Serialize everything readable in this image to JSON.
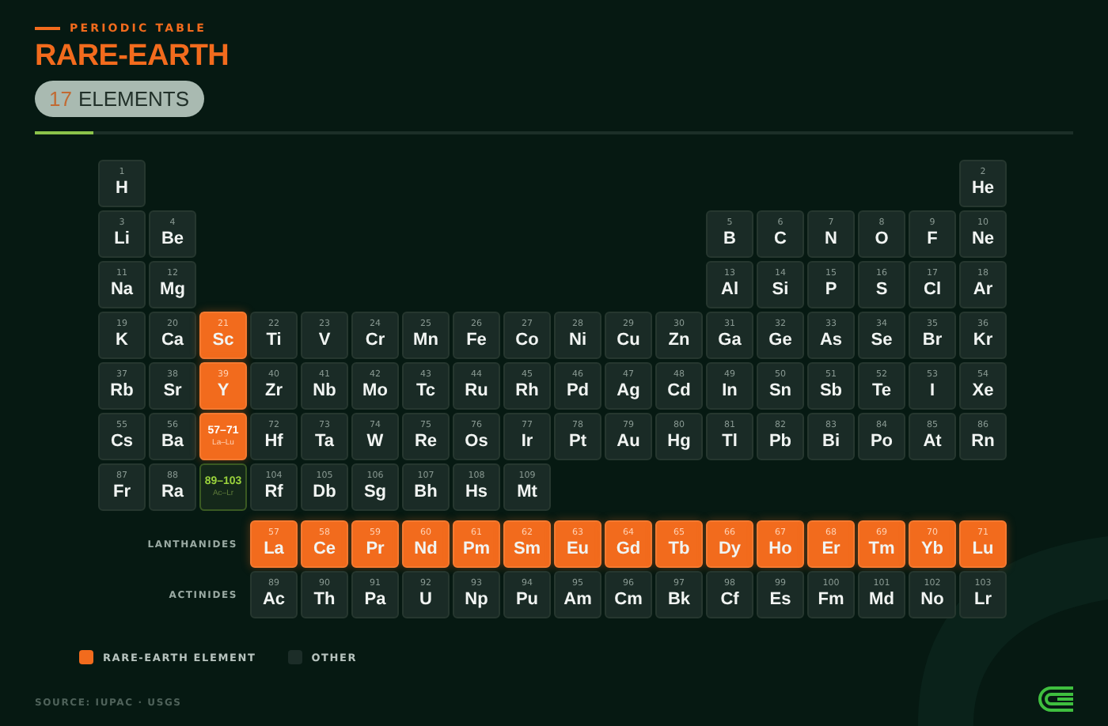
{
  "header": {
    "eyebrow": "PERIODIC TABLE",
    "title": "RARE-EARTH",
    "pill": {
      "count": "17",
      "label": "ELEMENTS"
    }
  },
  "table": {
    "rows": [
      {
        "left": [
          {
            "kind": "element",
            "number": "1",
            "symbol": "H",
            "rare_earth": false
          }
        ],
        "right": [
          {
            "kind": "element",
            "number": "2",
            "symbol": "He",
            "rare_earth": false
          }
        ]
      },
      {
        "left": [
          {
            "kind": "element",
            "number": "3",
            "symbol": "Li",
            "rare_earth": false
          },
          {
            "kind": "element",
            "number": "4",
            "symbol": "Be",
            "rare_earth": false
          }
        ],
        "right": [
          {
            "kind": "element",
            "number": "5",
            "symbol": "B",
            "rare_earth": false
          },
          {
            "kind": "element",
            "number": "6",
            "symbol": "C",
            "rare_earth": false
          },
          {
            "kind": "element",
            "number": "7",
            "symbol": "N",
            "rare_earth": false
          },
          {
            "kind": "element",
            "number": "8",
            "symbol": "O",
            "rare_earth": false
          },
          {
            "kind": "element",
            "number": "9",
            "symbol": "F",
            "rare_earth": false
          },
          {
            "kind": "element",
            "number": "10",
            "symbol": "Ne",
            "rare_earth": false
          }
        ]
      },
      {
        "left": [
          {
            "kind": "element",
            "number": "11",
            "symbol": "Na",
            "rare_earth": false
          },
          {
            "kind": "element",
            "number": "12",
            "symbol": "Mg",
            "rare_earth": false
          }
        ],
        "right": [
          {
            "kind": "element",
            "number": "13",
            "symbol": "Al",
            "rare_earth": false
          },
          {
            "kind": "element",
            "number": "14",
            "symbol": "Si",
            "rare_earth": false
          },
          {
            "kind": "element",
            "number": "15",
            "symbol": "P",
            "rare_earth": false
          },
          {
            "kind": "element",
            "number": "16",
            "symbol": "S",
            "rare_earth": false
          },
          {
            "kind": "element",
            "number": "17",
            "symbol": "Cl",
            "rare_earth": false
          },
          {
            "kind": "element",
            "number": "18",
            "symbol": "Ar",
            "rare_earth": false
          }
        ]
      },
      {
        "left": [
          {
            "kind": "element",
            "number": "19",
            "symbol": "K",
            "rare_earth": false
          },
          {
            "kind": "element",
            "number": "20",
            "symbol": "Ca",
            "rare_earth": false
          },
          {
            "kind": "element",
            "number": "21",
            "symbol": "Sc",
            "rare_earth": true
          },
          {
            "kind": "element",
            "number": "22",
            "symbol": "Ti",
            "rare_earth": false
          },
          {
            "kind": "element",
            "number": "23",
            "symbol": "V",
            "rare_earth": false
          },
          {
            "kind": "element",
            "number": "24",
            "symbol": "Cr",
            "rare_earth": false
          },
          {
            "kind": "element",
            "number": "25",
            "symbol": "Mn",
            "rare_earth": false
          },
          {
            "kind": "element",
            "number": "26",
            "symbol": "Fe",
            "rare_earth": false
          },
          {
            "kind": "element",
            "number": "27",
            "symbol": "Co",
            "rare_earth": false
          },
          {
            "kind": "element",
            "number": "28",
            "symbol": "Ni",
            "rare_earth": false
          },
          {
            "kind": "element",
            "number": "29",
            "symbol": "Cu",
            "rare_earth": false
          },
          {
            "kind": "element",
            "number": "30",
            "symbol": "Zn",
            "rare_earth": false
          },
          {
            "kind": "element",
            "number": "31",
            "symbol": "Ga",
            "rare_earth": false
          },
          {
            "kind": "element",
            "number": "32",
            "symbol": "Ge",
            "rare_earth": false
          },
          {
            "kind": "element",
            "number": "33",
            "symbol": "As",
            "rare_earth": false
          },
          {
            "kind": "element",
            "number": "34",
            "symbol": "Se",
            "rare_earth": false
          },
          {
            "kind": "element",
            "number": "35",
            "symbol": "Br",
            "rare_earth": false
          },
          {
            "kind": "element",
            "number": "36",
            "symbol": "Kr",
            "rare_earth": false
          }
        ],
        "right": []
      },
      {
        "left": [
          {
            "kind": "element",
            "number": "37",
            "symbol": "Rb",
            "rare_earth": false
          },
          {
            "kind": "element",
            "number": "38",
            "symbol": "Sr",
            "rare_earth": false
          },
          {
            "kind": "element",
            "number": "39",
            "symbol": "Y",
            "rare_earth": true
          },
          {
            "kind": "element",
            "number": "40",
            "symbol": "Zr",
            "rare_earth": false
          },
          {
            "kind": "element",
            "number": "41",
            "symbol": "Nb",
            "rare_earth": false
          },
          {
            "kind": "element",
            "number": "42",
            "symbol": "Mo",
            "rare_earth": false
          },
          {
            "kind": "element",
            "number": "43",
            "symbol": "Tc",
            "rare_earth": false
          },
          {
            "kind": "element",
            "number": "44",
            "symbol": "Ru",
            "rare_earth": false
          },
          {
            "kind": "element",
            "number": "45",
            "symbol": "Rh",
            "rare_earth": false
          },
          {
            "kind": "element",
            "number": "46",
            "symbol": "Pd",
            "rare_earth": false
          },
          {
            "kind": "element",
            "number": "47",
            "symbol": "Ag",
            "rare_earth": false
          },
          {
            "kind": "element",
            "number": "48",
            "symbol": "Cd",
            "rare_earth": false
          },
          {
            "kind": "element",
            "number": "49",
            "symbol": "In",
            "rare_earth": false
          },
          {
            "kind": "element",
            "number": "50",
            "symbol": "Sn",
            "rare_earth": false
          },
          {
            "kind": "element",
            "number": "51",
            "symbol": "Sb",
            "rare_earth": false
          },
          {
            "kind": "element",
            "number": "52",
            "symbol": "Te",
            "rare_earth": false
          },
          {
            "kind": "element",
            "number": "53",
            "symbol": "I",
            "rare_earth": false
          },
          {
            "kind": "element",
            "number": "54",
            "symbol": "Xe",
            "rare_earth": false
          }
        ],
        "right": []
      },
      {
        "left": [
          {
            "kind": "element",
            "number": "55",
            "symbol": "Cs",
            "rare_earth": false
          },
          {
            "kind": "element",
            "number": "56",
            "symbol": "Ba",
            "rare_earth": false
          },
          {
            "kind": "range",
            "number": "57–71",
            "symbol": "La–Lu",
            "rare_earth": true
          },
          {
            "kind": "element",
            "number": "72",
            "symbol": "Hf",
            "rare_earth": false
          },
          {
            "kind": "element",
            "number": "73",
            "symbol": "Ta",
            "rare_earth": false
          },
          {
            "kind": "element",
            "number": "74",
            "symbol": "W",
            "rare_earth": false
          },
          {
            "kind": "element",
            "number": "75",
            "symbol": "Re",
            "rare_earth": false
          },
          {
            "kind": "element",
            "number": "76",
            "symbol": "Os",
            "rare_earth": false
          },
          {
            "kind": "element",
            "number": "77",
            "symbol": "Ir",
            "rare_earth": false
          },
          {
            "kind": "element",
            "number": "78",
            "symbol": "Pt",
            "rare_earth": false
          },
          {
            "kind": "element",
            "number": "79",
            "symbol": "Au",
            "rare_earth": false
          },
          {
            "kind": "element",
            "number": "80",
            "symbol": "Hg",
            "rare_earth": false
          },
          {
            "kind": "element",
            "number": "81",
            "symbol": "Tl",
            "rare_earth": false
          },
          {
            "kind": "element",
            "number": "82",
            "symbol": "Pb",
            "rare_earth": false
          },
          {
            "kind": "element",
            "number": "83",
            "symbol": "Bi",
            "rare_earth": false
          },
          {
            "kind": "element",
            "number": "84",
            "symbol": "Po",
            "rare_earth": false
          },
          {
            "kind": "element",
            "number": "85",
            "symbol": "At",
            "rare_earth": false
          },
          {
            "kind": "element",
            "number": "86",
            "symbol": "Rn",
            "rare_earth": false
          }
        ],
        "right": []
      },
      {
        "left": [
          {
            "kind": "element",
            "number": "87",
            "symbol": "Fr",
            "rare_earth": false
          },
          {
            "kind": "element",
            "number": "88",
            "symbol": "Ra",
            "rare_earth": false
          },
          {
            "kind": "range",
            "number": "89–103",
            "symbol": "Ac–Lr",
            "rare_earth": false
          },
          {
            "kind": "element",
            "number": "104",
            "symbol": "Rf",
            "rare_earth": false
          },
          {
            "kind": "element",
            "number": "105",
            "symbol": "Db",
            "rare_earth": false
          },
          {
            "kind": "element",
            "number": "106",
            "symbol": "Sg",
            "rare_earth": false
          },
          {
            "kind": "element",
            "number": "107",
            "symbol": "Bh",
            "rare_earth": false
          },
          {
            "kind": "element",
            "number": "108",
            "symbol": "Hs",
            "rare_earth": false
          },
          {
            "kind": "element",
            "number": "109",
            "symbol": "Mt",
            "rare_earth": false
          }
        ],
        "right": []
      }
    ],
    "series": [
      {
        "label": "LANTHANIDES",
        "cells": [
          {
            "kind": "element",
            "number": "57",
            "symbol": "La",
            "rare_earth": true
          },
          {
            "kind": "element",
            "number": "58",
            "symbol": "Ce",
            "rare_earth": true
          },
          {
            "kind": "element",
            "number": "59",
            "symbol": "Pr",
            "rare_earth": true
          },
          {
            "kind": "element",
            "number": "60",
            "symbol": "Nd",
            "rare_earth": true
          },
          {
            "kind": "element",
            "number": "61",
            "symbol": "Pm",
            "rare_earth": true
          },
          {
            "kind": "element",
            "number": "62",
            "symbol": "Sm",
            "rare_earth": true
          },
          {
            "kind": "element",
            "number": "63",
            "symbol": "Eu",
            "rare_earth": true
          },
          {
            "kind": "element",
            "number": "64",
            "symbol": "Gd",
            "rare_earth": true
          },
          {
            "kind": "element",
            "number": "65",
            "symbol": "Tb",
            "rare_earth": true
          },
          {
            "kind": "element",
            "number": "66",
            "symbol": "Dy",
            "rare_earth": true
          },
          {
            "kind": "element",
            "number": "67",
            "symbol": "Ho",
            "rare_earth": true
          },
          {
            "kind": "element",
            "number": "68",
            "symbol": "Er",
            "rare_earth": true
          },
          {
            "kind": "element",
            "number": "69",
            "symbol": "Tm",
            "rare_earth": true
          },
          {
            "kind": "element",
            "number": "70",
            "symbol": "Yb",
            "rare_earth": true
          },
          {
            "kind": "element",
            "number": "71",
            "symbol": "Lu",
            "rare_earth": true
          }
        ]
      },
      {
        "label": "ACTINIDES",
        "cells": [
          {
            "kind": "element",
            "number": "89",
            "symbol": "Ac",
            "rare_earth": false
          },
          {
            "kind": "element",
            "number": "90",
            "symbol": "Th",
            "rare_earth": false
          },
          {
            "kind": "element",
            "number": "91",
            "symbol": "Pa",
            "rare_earth": false
          },
          {
            "kind": "element",
            "number": "92",
            "symbol": "U",
            "rare_earth": false
          },
          {
            "kind": "element",
            "number": "93",
            "symbol": "Np",
            "rare_earth": false
          },
          {
            "kind": "element",
            "number": "94",
            "symbol": "Pu",
            "rare_earth": false
          },
          {
            "kind": "element",
            "number": "95",
            "symbol": "Am",
            "rare_earth": false
          },
          {
            "kind": "element",
            "number": "96",
            "symbol": "Cm",
            "rare_earth": false
          },
          {
            "kind": "element",
            "number": "97",
            "symbol": "Bk",
            "rare_earth": false
          },
          {
            "kind": "element",
            "number": "98",
            "symbol": "Cf",
            "rare_earth": false
          },
          {
            "kind": "element",
            "number": "99",
            "symbol": "Es",
            "rare_earth": false
          },
          {
            "kind": "element",
            "number": "100",
            "symbol": "Fm",
            "rare_earth": false
          },
          {
            "kind": "element",
            "number": "101",
            "symbol": "Md",
            "rare_earth": false
          },
          {
            "kind": "element",
            "number": "102",
            "symbol": "No",
            "rare_earth": false
          },
          {
            "kind": "element",
            "number": "103",
            "symbol": "Lr",
            "rare_earth": false
          }
        ]
      }
    ]
  },
  "legend": [
    {
      "label": "RARE-EARTH ELEMENT",
      "color": "#f26b1d"
    },
    {
      "label": "OTHER",
      "color": "#1c2d28"
    }
  ],
  "source": "SOURCE: IUPAC · USGS"
}
